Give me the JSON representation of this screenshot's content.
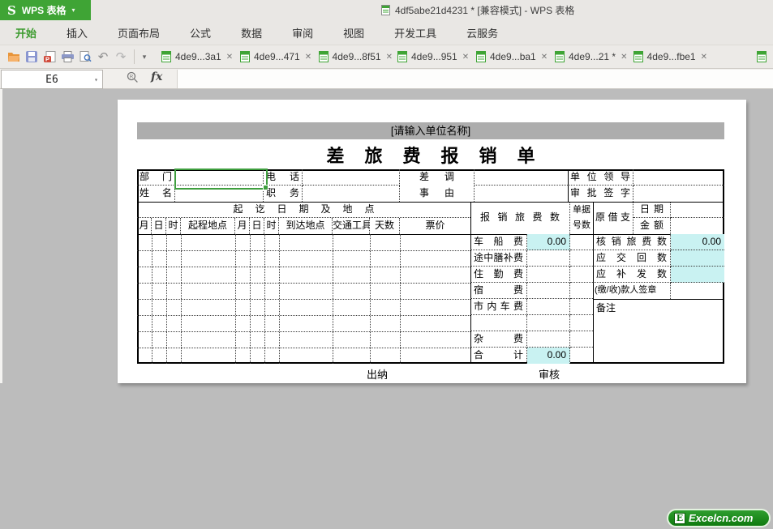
{
  "titlebar": {
    "logo_s": "S",
    "logo_text": "WPS 表格",
    "doc_title": "4df5abe21d4231 * [兼容模式] - WPS 表格"
  },
  "icons": {
    "caret": "▾",
    "close": "✕",
    "undo": "↶",
    "redo": "↷"
  },
  "menu": {
    "items": [
      "开始",
      "插入",
      "页面布局",
      "公式",
      "数据",
      "审阅",
      "视图",
      "开发工具",
      "云服务"
    ]
  },
  "doc_tabs": [
    "4de9...3a1",
    "4de9...471",
    "4de9...8f51",
    "4de9...951",
    "4de9...ba1",
    "4de9...21 *",
    "4de9...fbe1"
  ],
  "formula_bar": {
    "cell_ref": "E6",
    "fx": "fx"
  },
  "form": {
    "banner": "[请输入单位名称]",
    "title": "差旅费报销单",
    "dept": "部门",
    "phone": "电话",
    "name": "姓名",
    "job": "职务",
    "reason_l1": "差调",
    "reason_l2": "事由",
    "leader_l1": "单位领导",
    "leader_l2": "审批签字",
    "route_header": "起讫日期及地点",
    "day_cols": [
      "月",
      "日",
      "时",
      "起程地点",
      "月",
      "日",
      "时",
      "到达地点",
      "交通工具",
      "天数",
      "票价"
    ],
    "claim_header": "报销旅费数",
    "receipt_l1": "单据",
    "receipt_l2": "号数",
    "loan": "原借支",
    "date": "日期",
    "amount": "金额",
    "fee_rows": [
      {
        "label": "车船费",
        "value": "0.00"
      },
      {
        "label": "途中膳补费",
        "value": ""
      },
      {
        "label": "住勤费",
        "value": ""
      },
      {
        "label": "宿费",
        "value": ""
      },
      {
        "label": "市内车费",
        "value": ""
      },
      {
        "label": "",
        "value": ""
      },
      {
        "label": "杂费",
        "value": ""
      },
      {
        "label": "合计",
        "value": "0.00"
      }
    ],
    "right_rows": [
      {
        "label": "核销旅费数",
        "value": "0.00"
      },
      {
        "label": "应交回数",
        "value": ""
      },
      {
        "label": "应补发数",
        "value": ""
      },
      {
        "label": "(缴/收)款人签章",
        "value": ""
      }
    ],
    "note": "备注",
    "cashier": "出纳",
    "auditor": "审核"
  },
  "brand": {
    "letter": "E",
    "text": "Excelcn.com"
  },
  "colors": {
    "wps_green": "#3fa435",
    "selection_green": "#3f9e3f",
    "cell_cyan": "#c9f2f2",
    "banner_gray": "#adadad",
    "brand_green": "#0f7a0f",
    "canvas_gray": "#bcbcbc"
  }
}
